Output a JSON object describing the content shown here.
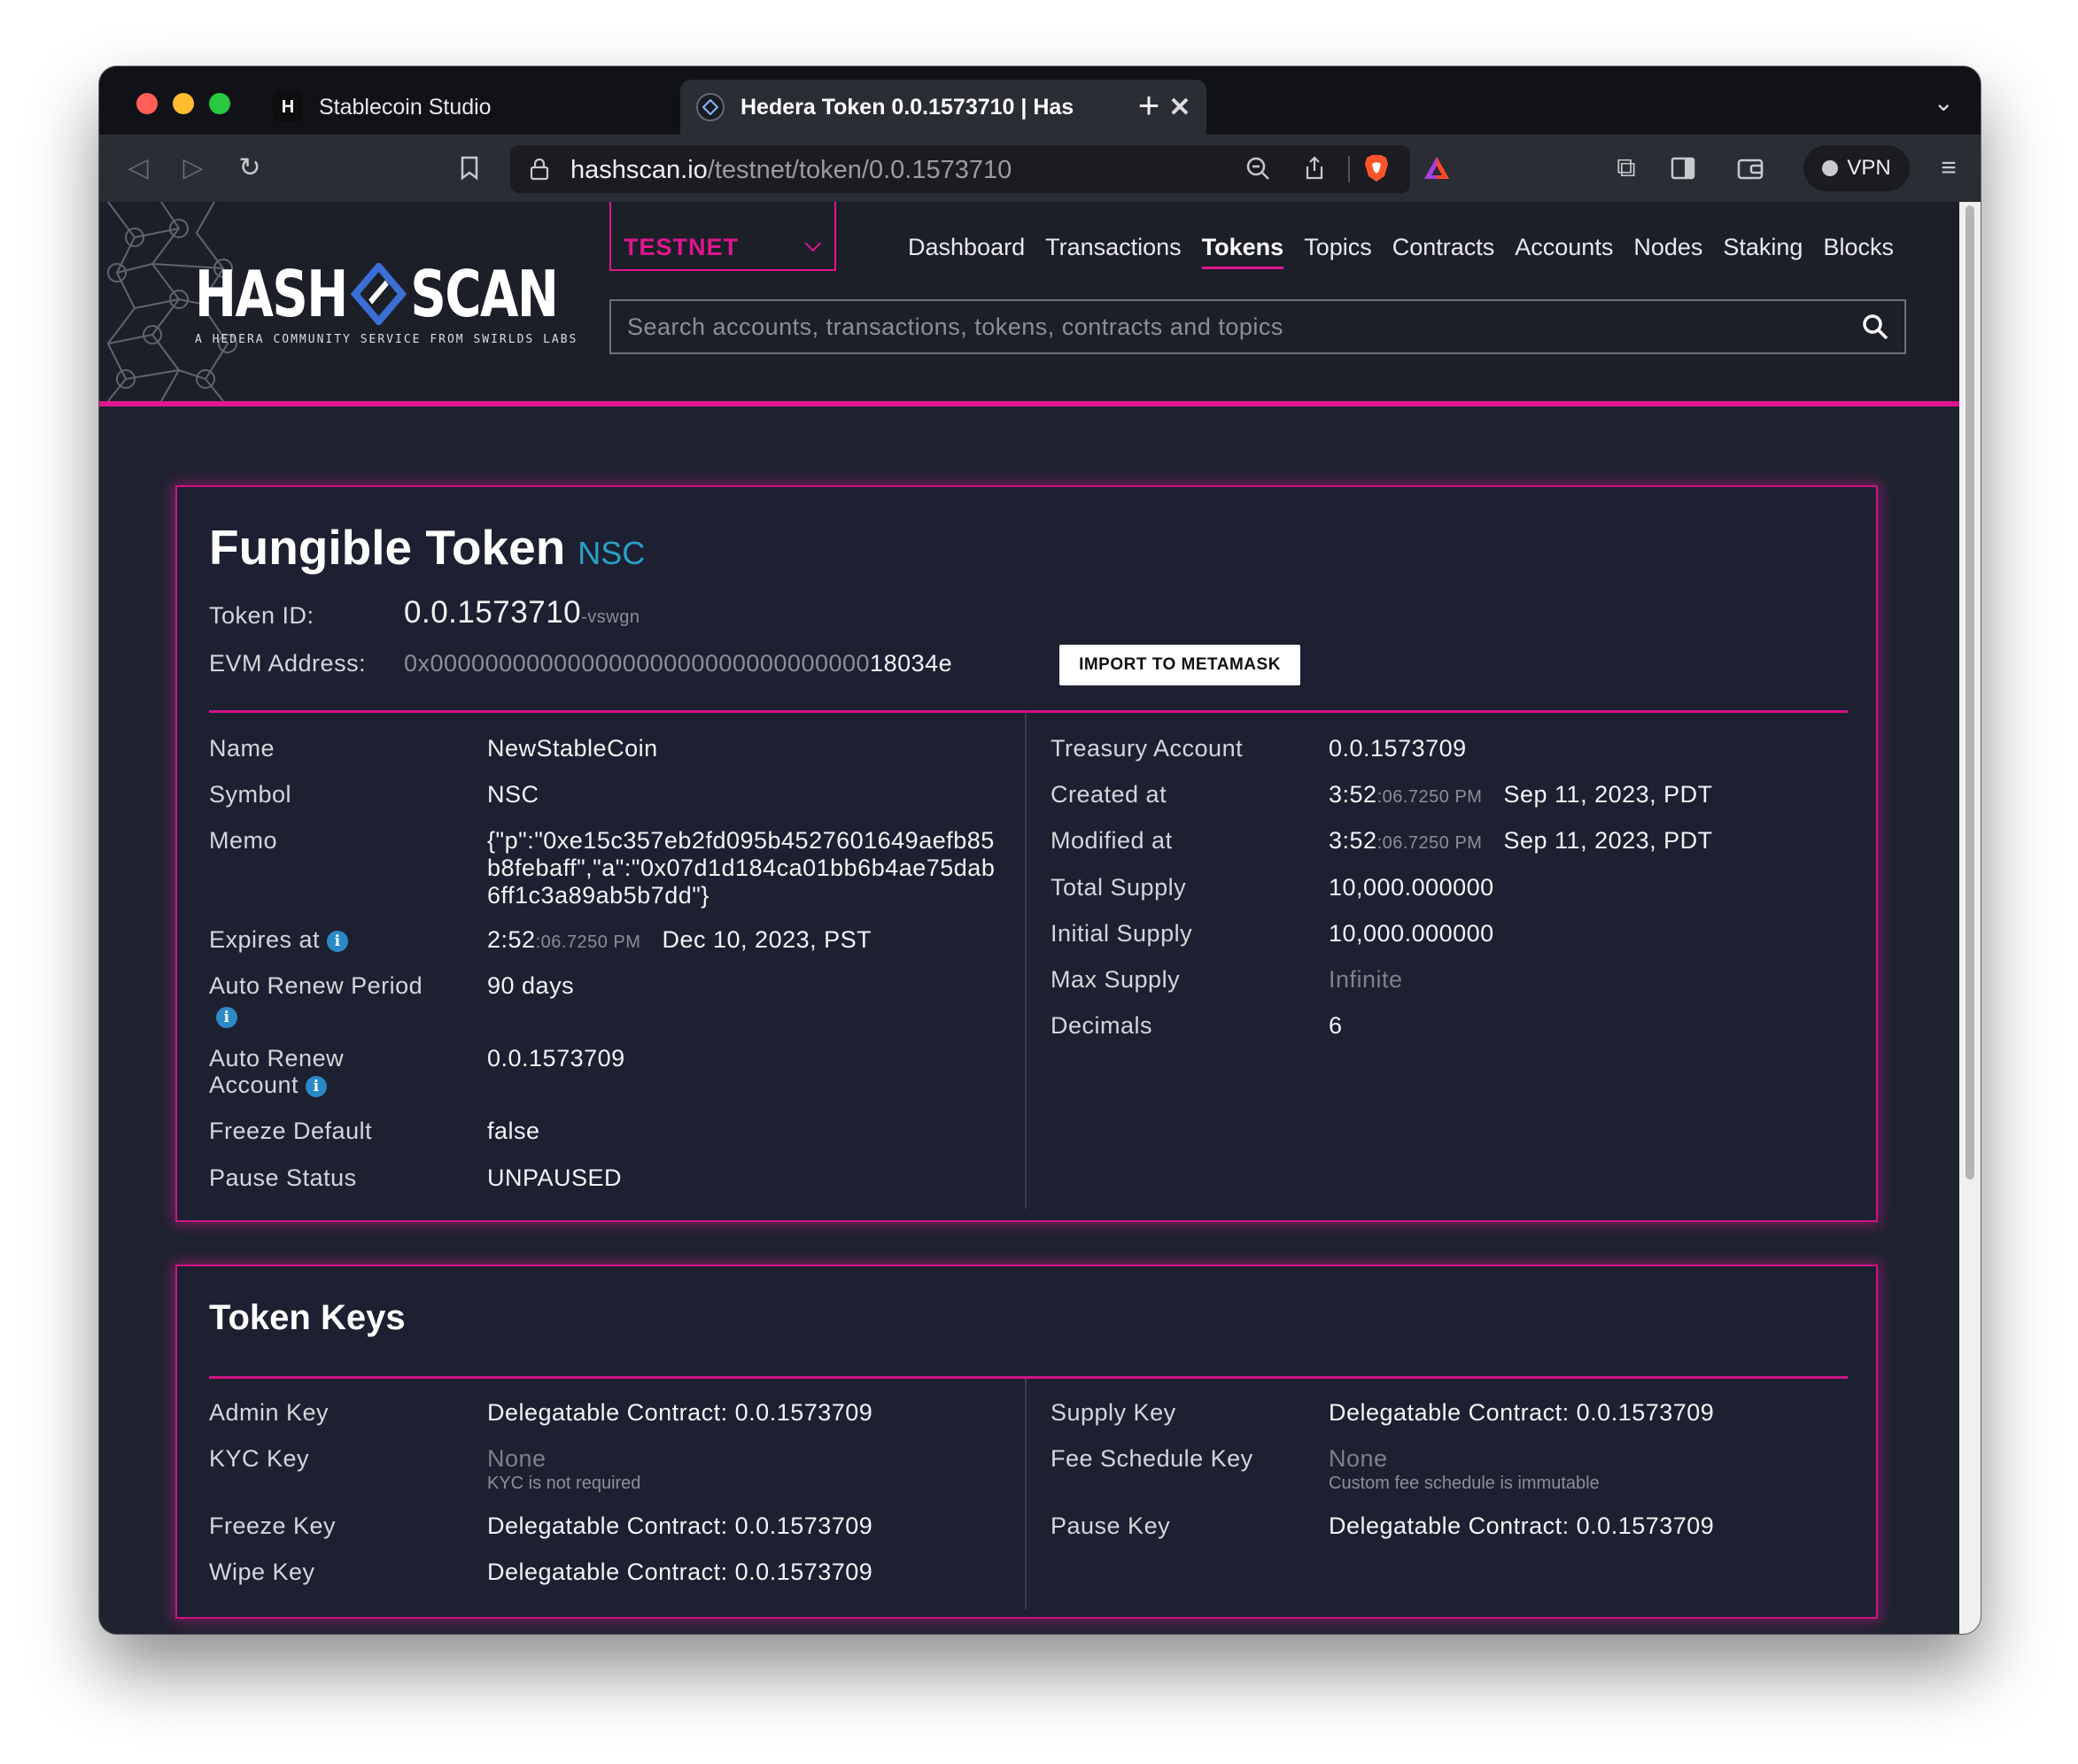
{
  "browser": {
    "tabs": [
      {
        "label": "Stablecoin Studio",
        "favicon": "H"
      },
      {
        "label": "Hedera Token 0.0.1573710 | Has",
        "active": true
      }
    ],
    "url_domain": "hashscan.io",
    "url_path": "/testnet/token/0.0.1573710",
    "vpn_label": "VPN"
  },
  "header": {
    "logo_left": "HASH",
    "logo_right": "SCAN",
    "logo_tagline": "A HEDERA COMMUNITY SERVICE FROM SWIRLDS LABS",
    "network": "TESTNET",
    "nav": [
      "Dashboard",
      "Transactions",
      "Tokens",
      "Topics",
      "Contracts",
      "Accounts",
      "Nodes",
      "Staking",
      "Blocks"
    ],
    "active_nav": "Tokens",
    "search_placeholder": "Search accounts, transactions, tokens, contracts and topics"
  },
  "token": {
    "title": "Fungible Token",
    "symbol_badge": "NSC",
    "token_id_label": "Token ID:",
    "token_id": "0.0.1573710",
    "token_id_checksum": "-vswgn",
    "evm_label": "EVM Address:",
    "evm_prefix": "0x00000000000000000000000000000000",
    "evm_suffix": "18034e",
    "import_button": "IMPORT TO METAMASK",
    "left": {
      "name_label": "Name",
      "name": "NewStableCoin",
      "symbol_label": "Symbol",
      "symbol": "NSC",
      "memo_label": "Memo",
      "memo": "{\"p\":\"0xe15c357eb2fd095b4527601649aefb85b8febaff\",\"a\":\"0x07d1d184ca01bb6b4ae75dab6ff1c3a89ab5b7dd\"}",
      "expires_label": "Expires at",
      "expires_time": "2:52",
      "expires_secs": ":06.7250 PM",
      "expires_date": "Dec 10, 2023, PST",
      "renew_period_label": "Auto Renew Period",
      "renew_period": "90 days",
      "renew_account_label_1": "Auto Renew",
      "renew_account_label_2": "Account",
      "renew_account": "0.0.1573709",
      "freeze_default_label": "Freeze Default",
      "freeze_default": "false",
      "pause_status_label": "Pause Status",
      "pause_status": "UNPAUSED"
    },
    "right": {
      "treasury_label": "Treasury Account",
      "treasury": "0.0.1573709",
      "created_label": "Created at",
      "created_time": "3:52",
      "created_secs": ":06.7250 PM",
      "created_date": "Sep 11, 2023, PDT",
      "modified_label": "Modified at",
      "modified_time": "3:52",
      "modified_secs": ":06.7250 PM",
      "modified_date": "Sep 11, 2023, PDT",
      "total_supply_label": "Total Supply",
      "total_supply": "10,000.000000",
      "initial_supply_label": "Initial Supply",
      "initial_supply": "10,000.000000",
      "max_supply_label": "Max Supply",
      "max_supply": "Infinite",
      "decimals_label": "Decimals",
      "decimals": "6"
    }
  },
  "keys": {
    "title": "Token Keys",
    "admin_label": "Admin Key",
    "admin": "Delegatable Contract: 0.0.1573709",
    "kyc_label": "KYC Key",
    "kyc": "None",
    "kyc_note": "KYC is not required",
    "freeze_label": "Freeze Key",
    "freeze": "Delegatable Contract: 0.0.1573709",
    "wipe_label": "Wipe Key",
    "wipe": "Delegatable Contract: 0.0.1573709",
    "supply_label": "Supply Key",
    "supply": "Delegatable Contract: 0.0.1573709",
    "fee_label": "Fee Schedule Key",
    "fee": "None",
    "fee_note": "Custom fee schedule is immutable",
    "pause_label": "Pause Key",
    "pause": "Delegatable Contract: 0.0.1573709"
  },
  "colors": {
    "accent": "#e0168e",
    "background": "#1f2330",
    "symbol_badge": "#2aa0c8",
    "info": "#2b8ac6"
  }
}
